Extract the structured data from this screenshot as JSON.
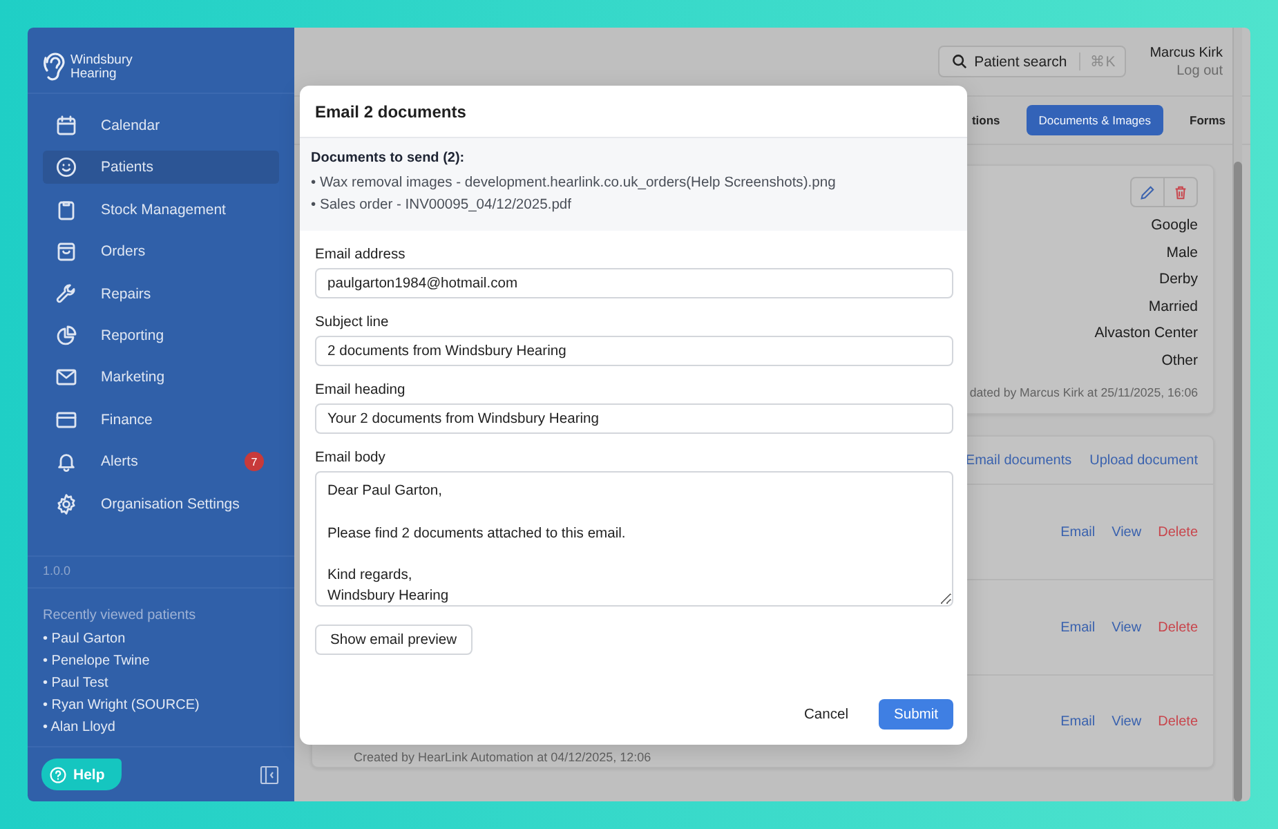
{
  "sidebar": {
    "logo": "Windsbury Hearing",
    "items": [
      {
        "label": "Calendar",
        "selected": false
      },
      {
        "label": "Patients",
        "selected": true
      },
      {
        "label": "Stock Management",
        "selected": false
      },
      {
        "label": "Orders",
        "selected": false
      },
      {
        "label": "Repairs",
        "selected": false
      },
      {
        "label": "Reporting",
        "selected": false
      },
      {
        "label": "Marketing",
        "selected": false
      },
      {
        "label": "Finance",
        "selected": false
      },
      {
        "label": "Alerts",
        "selected": false,
        "badge": "7"
      },
      {
        "label": "Organisation Settings",
        "selected": false
      }
    ],
    "version": "1.0.0",
    "recent_title": "Recently viewed patients",
    "recent": [
      "• Paul Garton",
      "• Penelope Twine",
      "• Paul Test",
      "• Ryan Wright (SOURCE)",
      "• Alan Lloyd"
    ],
    "help": "Help"
  },
  "header": {
    "search": {
      "label": "Patient search",
      "shortcut": "⌘K"
    },
    "user": {
      "name": "Marcus Kirk",
      "logout": "Log out"
    }
  },
  "tabs": [
    {
      "label": "tions",
      "selected": false
    },
    {
      "label": "Documents & Images",
      "selected": true
    },
    {
      "label": "Forms",
      "selected": false
    }
  ],
  "details_card": {
    "values": [
      "Google",
      "Male",
      "Derby",
      "Married",
      "Alvaston Center",
      "Other"
    ],
    "footer": "dated by Marcus Kirk at 25/11/2025, 16:06"
  },
  "documents_card": {
    "actions": [
      "Email documents",
      "Upload document"
    ],
    "rows": [
      {
        "actions": [
          {
            "label": "Email",
            "kind": "link"
          },
          {
            "label": "View",
            "kind": "link"
          },
          {
            "label": "Delete",
            "kind": "danger"
          }
        ]
      },
      {
        "actions": [
          {
            "label": "Email",
            "kind": "link"
          },
          {
            "label": "View",
            "kind": "link"
          },
          {
            "label": "Delete",
            "kind": "danger"
          }
        ]
      },
      {
        "actions": [
          {
            "label": "Email",
            "kind": "link"
          },
          {
            "label": "View",
            "kind": "link"
          },
          {
            "label": "Delete",
            "kind": "danger"
          }
        ],
        "note": "Created by HearLink Automation at 04/12/2025, 12:06"
      }
    ]
  },
  "modal": {
    "title": "Email 2 documents",
    "documents_heading": "Documents to send (2):",
    "documents": [
      "• Wax removal images - development.hearlink.co.uk_orders(Help Screenshots).png",
      "• Sales order - INV00095_04/12/2025.pdf"
    ],
    "fields": [
      {
        "label": "Email address",
        "kind": "input",
        "value": "paulgarton1984@hotmail.com"
      },
      {
        "label": "Subject line",
        "kind": "input",
        "value": "2 documents from Windsbury Hearing"
      },
      {
        "label": "Email heading",
        "kind": "input",
        "value": "Your 2 documents from Windsbury Hearing"
      },
      {
        "label": "Email body",
        "kind": "textarea",
        "value": "Dear Paul Garton,\n\nPlease find 2 documents attached to this email.\n\nKind regards,\nWindsbury Hearing"
      }
    ],
    "preview_button": "Show email preview",
    "cancel": "Cancel",
    "submit": "Submit"
  }
}
